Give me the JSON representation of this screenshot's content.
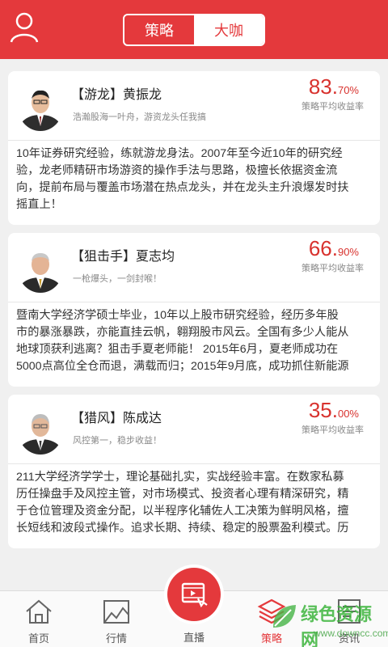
{
  "header": {
    "tabs": [
      {
        "label": "策略",
        "active": false
      },
      {
        "label": "大咖",
        "active": true
      }
    ]
  },
  "cards": [
    {
      "name": "【游龙】黄振龙",
      "motto": "浩瀚股海一叶舟，游资龙头任我搞",
      "rate_int": "83.",
      "rate_dec": "70%",
      "rate_label": "策略平均收益率",
      "desc": [
        "10年证券研究经验，练就游龙身法。2007年至今近10年的研究经",
        "验，龙老师精研市场游资的操作手法与思路，极擅长依据资金流",
        "向，提前布局与覆盖市场潜在热点龙头，并在龙头主升浪爆发时扶",
        "摇直上！"
      ]
    },
    {
      "name": "【狙击手】夏志均",
      "motto": "一枪爆头，一剑封喉！",
      "rate_int": "66.",
      "rate_dec": "90%",
      "rate_label": "策略平均收益率",
      "desc": [
        "暨南大学经济学硕士毕业，10年以上股市研究经验，经历多年股",
        "市的暴涨暴跌，亦能直挂云帆，翱翔股市风云。全国有多少人能从",
        "地球顶获利逃离？狙击手夏老师能！ 2015年6月，夏老师成功在",
        "5000点高位全仓而退，满载而归；2015年9月底，成功抓住新能源"
      ]
    },
    {
      "name": "【猎风】陈成达",
      "motto": "风控第一，稳步收益！",
      "rate_int": "35.",
      "rate_dec": "00%",
      "rate_label": "策略平均收益率",
      "desc": [
        "211大学经济学学士，理论基础扎实，实战经验丰富。在数家私募",
        "历任操盘手及风控主管，对市场模式、投资者心理有精深研究，精",
        "于仓位管理及资金分配，以半程序化辅佐人工决策为鲜明风格，擅",
        "长短线和波段式操作。追求长期、持续、稳定的股票盈利模式。历"
      ]
    }
  ],
  "tabbar": {
    "items": [
      {
        "label": "首页",
        "icon": "home-icon"
      },
      {
        "label": "行情",
        "icon": "chart-icon"
      },
      {
        "label": "直播",
        "icon": "video-icon"
      },
      {
        "label": "策略",
        "icon": "strategy-icon",
        "active": true
      },
      {
        "label": "资讯",
        "icon": "news-icon"
      }
    ]
  },
  "watermark": {
    "text": "绿色资源网",
    "url": "www.downcc.com"
  },
  "colors": {
    "brand_red": "#e4393c",
    "rate_red": "#d8322e"
  }
}
